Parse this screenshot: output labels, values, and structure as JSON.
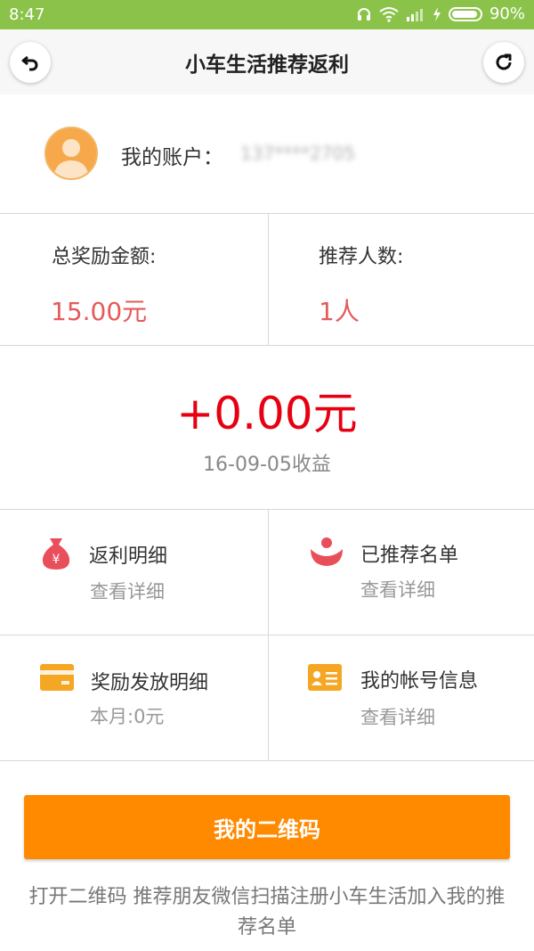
{
  "status_bar": {
    "time": "8:47",
    "battery": "90%"
  },
  "header": {
    "title": "小车生活推荐返利"
  },
  "account": {
    "label": "我的账户：",
    "value": "137****2705"
  },
  "stats": {
    "total_label": "总奖励金额:",
    "total_value": "15.00元",
    "count_label": "推荐人数:",
    "count_value": "1人"
  },
  "today": {
    "amount": "+0.00元",
    "date_label": "16-09-05收益"
  },
  "menu": [
    {
      "title": "返利明细",
      "subtitle": "查看详细",
      "icon": "money-bag-icon",
      "color": "#e94f5b"
    },
    {
      "title": "已推荐名单",
      "subtitle": "查看详细",
      "icon": "person-icon",
      "color": "#e94f5b"
    },
    {
      "title": "奖励发放明细",
      "subtitle": "本月:0元",
      "icon": "card-icon",
      "color": "#f5a623"
    },
    {
      "title": "我的帐号信息",
      "subtitle": "查看详细",
      "icon": "id-card-icon",
      "color": "#f5a623"
    }
  ],
  "qr_button": {
    "label": "我的二维码"
  },
  "note": "打开二维码 推荐朋友微信扫描注册小车生活加入我的推荐名单",
  "colors": {
    "status_bar": "#8bc34a",
    "accent": "#ff8a00",
    "highlight": "#e60012",
    "stat_value": "#e65a5a"
  }
}
